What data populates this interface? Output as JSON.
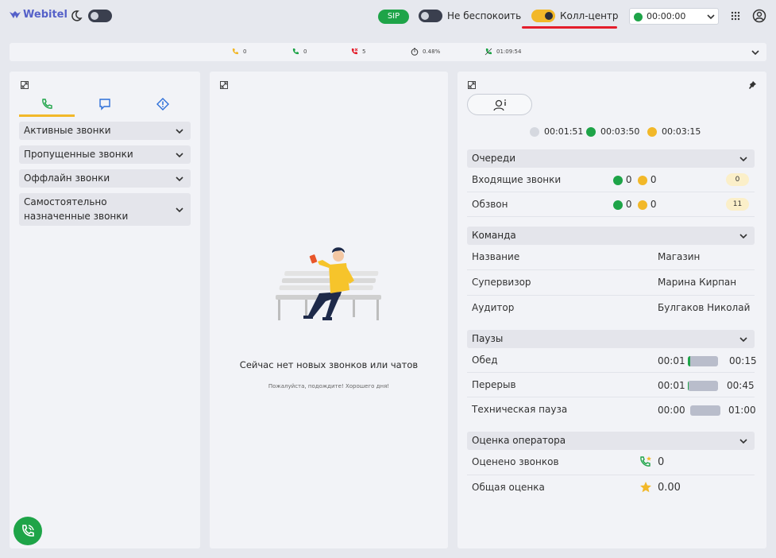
{
  "header": {
    "logo": "Webitel",
    "sip": "SIP",
    "dnd_label": "Не беспокоить",
    "callcenter_label": "Колл-центр",
    "status_time": "00:00:00"
  },
  "stats": [
    {
      "icon": "incoming-call-icon",
      "value": "0",
      "color": "#f2b829"
    },
    {
      "icon": "answered-call-icon",
      "value": "0",
      "color": "#1ea448"
    },
    {
      "icon": "missed-call-icon",
      "value": "5",
      "color": "#e41e2b"
    },
    {
      "icon": "timer-icon",
      "value": "0.48%",
      "color": "#333"
    },
    {
      "icon": "talk-time-icon",
      "value": "01:09:54",
      "color": "#1ea448"
    }
  ],
  "left": {
    "groups": [
      "Активные звонки",
      "Пропущенные звонки",
      "Оффлайн звонки",
      "Самостоятельно назначенные звонки"
    ]
  },
  "middle": {
    "empty_title": "Сейчас нет новых звонков или чатов",
    "empty_sub": "Пожалуйста, подождите! Хорошего дня!"
  },
  "right": {
    "timers": [
      "00:01:51",
      "00:03:50",
      "00:03:15"
    ],
    "queues": {
      "title": "Очереди",
      "rows": [
        {
          "label": "Входящие звонки",
          "green": "0",
          "yellow": "0",
          "badge": "0"
        },
        {
          "label": "Обзвон",
          "green": "0",
          "yellow": "0",
          "badge": "11"
        }
      ]
    },
    "team": {
      "title": "Команда",
      "rows": [
        {
          "label": "Название",
          "value": "Магазин"
        },
        {
          "label": "Супервизор",
          "value": "Марина Кирпан"
        },
        {
          "label": "Аудитор",
          "value": "Булгаков Николай"
        }
      ]
    },
    "pauses": {
      "title": "Паузы",
      "rows": [
        {
          "label": "Обед",
          "used": "00:01",
          "limit": "00:15",
          "progress": 0.067
        },
        {
          "label": "Перерыв",
          "used": "00:01",
          "limit": "00:45",
          "progress": 0.022
        },
        {
          "label": "Техническая пауза",
          "used": "00:00",
          "limit": "01:00",
          "progress": 0
        }
      ]
    },
    "rating": {
      "title": "Оценка оператора",
      "rows": [
        {
          "label": "Оценено звонков",
          "value": "0"
        },
        {
          "label": "Общая оценка",
          "value": "0.00"
        }
      ]
    }
  }
}
